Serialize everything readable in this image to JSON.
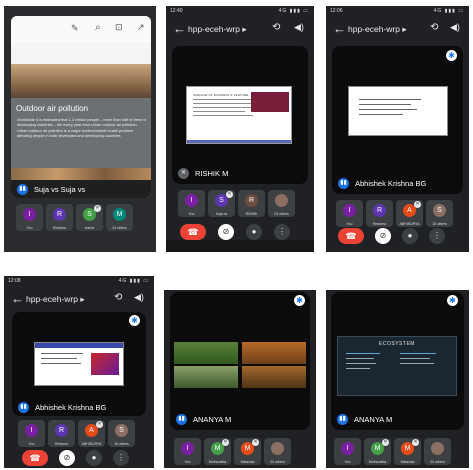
{
  "shots": {
    "s1": {
      "slide_title": "Outdoor air pollution",
      "bullets": [
        "Worldwide it is estimated that 1.3 million people – more than half of them in developing countries – die every year from urban outdoor air pollution.",
        "Urban outdoor air pollution is a major environmental health problem affecting people in both developed and developing countries"
      ],
      "caption": "Suja vs Suja vs",
      "tiles": [
        {
          "initial": "I",
          "name": "You",
          "color": "#7b1fa2"
        },
        {
          "initial": "R",
          "name": "Reshma",
          "color": "#5e35b1"
        },
        {
          "initial": "S",
          "name": "sneha",
          "color": "#43a047"
        },
        {
          "initial": "M",
          "name": "24 others",
          "color": "#00897b"
        }
      ]
    },
    "s2": {
      "time": "12:40",
      "status": "4G ▮▮▮ ▭",
      "title": "hpp-eceh-wrp ▸",
      "slide_heading": "SURFACE OF BUSINESS & VENTURE",
      "caption": "RISHIK M",
      "tiles": [
        {
          "initial": "I",
          "name": "You",
          "color": "#7b1fa2"
        },
        {
          "initial": "S",
          "name": "Suja vs",
          "color": "#5e35b1"
        },
        {
          "initial": "R",
          "name": "RISHIK",
          "color": "#6d4c41"
        },
        {
          "initial": "",
          "name": "23 others",
          "color": "#8d6e63"
        }
      ]
    },
    "s3": {
      "time": "12:06",
      "status": "4G ▮▮▮ ▭",
      "title": "hpp-eceh-wrp ▸",
      "caption": "Abhishek Krishna BG",
      "tiles": [
        {
          "initial": "I",
          "name": "You",
          "color": "#7b1fa2"
        },
        {
          "initial": "R",
          "name": "Reshma",
          "color": "#5e35b1"
        },
        {
          "initial": "A",
          "name": "ABHISURYA",
          "color": "#e64a19"
        },
        {
          "initial": "S",
          "name": "15 others",
          "color": "#8d6e63"
        }
      ]
    },
    "s4": {
      "time": "12:08",
      "status": "4G ▮▮▮ ▭",
      "title": "hpp-eceh-wrp ▸",
      "caption": "Abhishek Krishna BG",
      "tiles": [
        {
          "initial": "I",
          "name": "You",
          "color": "#7b1fa2"
        },
        {
          "initial": "R",
          "name": "Reshma",
          "color": "#5e35b1"
        },
        {
          "initial": "A",
          "name": "ABHISURYA",
          "color": "#e64a19"
        },
        {
          "initial": "S",
          "name": "16 others",
          "color": "#8d6e63"
        }
      ]
    },
    "s5": {
      "caption": "ANANYA M",
      "tiles": [
        {
          "initial": "I",
          "name": "You",
          "color": "#7b1fa2"
        },
        {
          "initial": "M",
          "name": "Muthuraiha",
          "color": "#43a047"
        },
        {
          "initial": "M",
          "name": "Malavika",
          "color": "#e64a19"
        },
        {
          "initial": "",
          "name": "23 others",
          "color": "#8d6e63"
        }
      ]
    },
    "s6": {
      "slide_title": "ECOSYSTEM",
      "caption": "ANANYA M",
      "tiles": [
        {
          "initial": "I",
          "name": "You",
          "color": "#7b1fa2"
        },
        {
          "initial": "M",
          "name": "Muthuraiha",
          "color": "#43a047"
        },
        {
          "initial": "M",
          "name": "Malavika",
          "color": "#e64a19"
        },
        {
          "initial": "",
          "name": "23 others",
          "color": "#8d6e63"
        }
      ]
    }
  },
  "icons": {
    "back": "arrow-back-icon",
    "switch_camera": "switch-camera-icon",
    "speaker": "speaker-icon",
    "settings": "gear-icon",
    "end_call": "end-call-icon",
    "camera_off": "camera-off-icon",
    "mic": "mic-icon",
    "more": "more-icon"
  }
}
